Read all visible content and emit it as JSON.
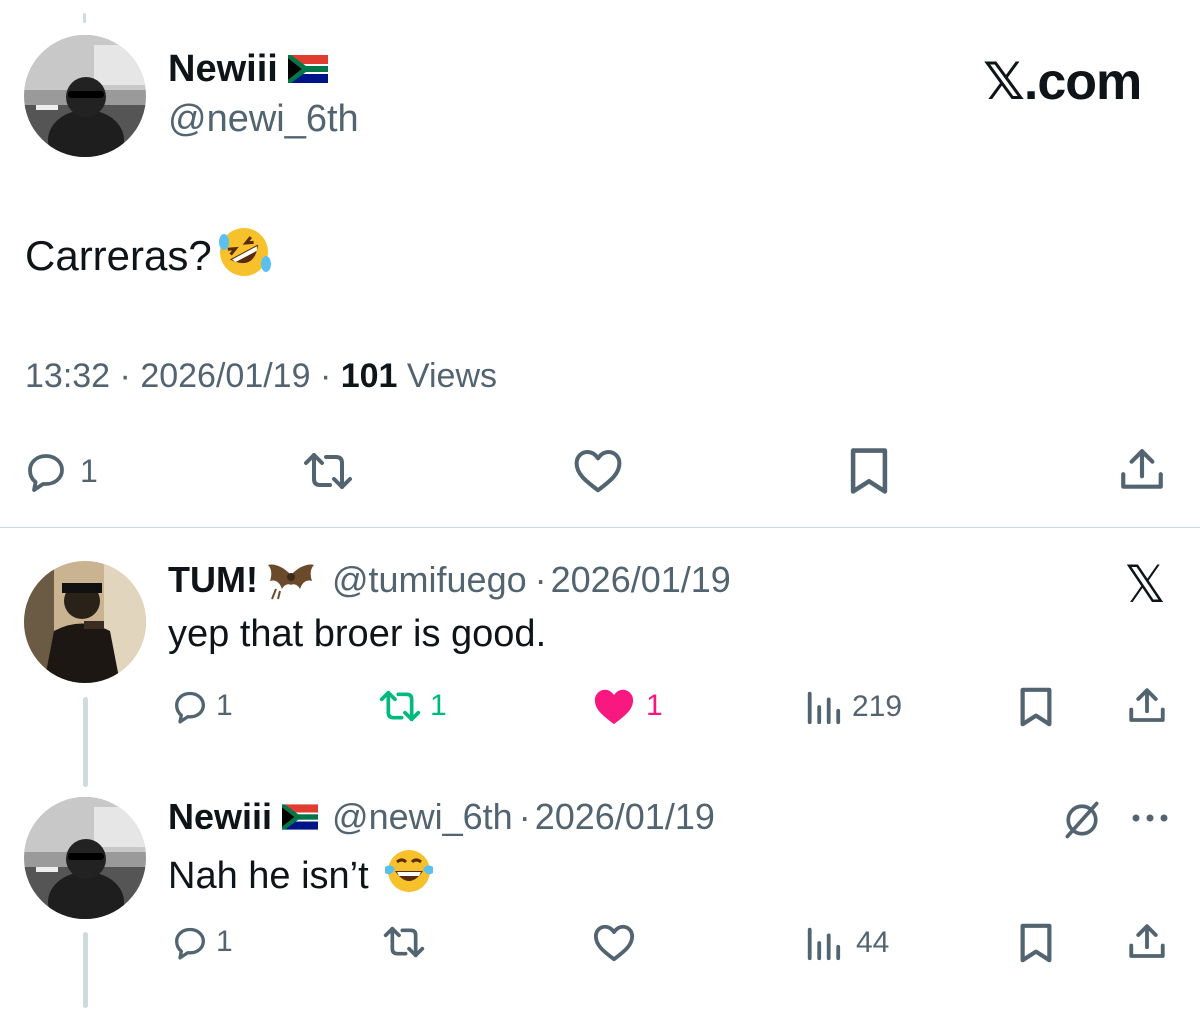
{
  "main_tweet": {
    "author_name": "Newiii",
    "author_flag": "south-africa-flag",
    "handle": "@newi_6th",
    "watermark": "𝕏.com",
    "text": "Carreras?",
    "text_emoji": "rolling-on-floor-laughing-emoji",
    "time": "13:32",
    "sep1": "·",
    "date": "2026/01/19",
    "sep2": "·",
    "views_count": "101",
    "views_label": "Views",
    "reply_count": "1"
  },
  "reply1": {
    "author_name": "TUM!",
    "author_emoji": "bat-emoji",
    "handle": "@tumifuego",
    "sep": "·",
    "date": "2026/01/19",
    "text": "yep that broer is good.",
    "reply_count": "1",
    "retweet_count": "1",
    "like_count": "1",
    "views_count": "219",
    "logo": "𝕏"
  },
  "reply2": {
    "author_name": "Newiii",
    "author_flag": "south-africa-flag",
    "handle": "@newi_6th",
    "sep": "·",
    "date": "2026/01/19",
    "text": "Nah he isn’t",
    "text_emoji": "face-with-tears-of-joy-emoji",
    "reply_count": "1",
    "views_count": "44"
  },
  "colors": {
    "text": "#0f1419",
    "muted": "#536471",
    "retweet_active": "#00ba7c",
    "like_active": "#f91880",
    "divider": "#cfd9de"
  }
}
